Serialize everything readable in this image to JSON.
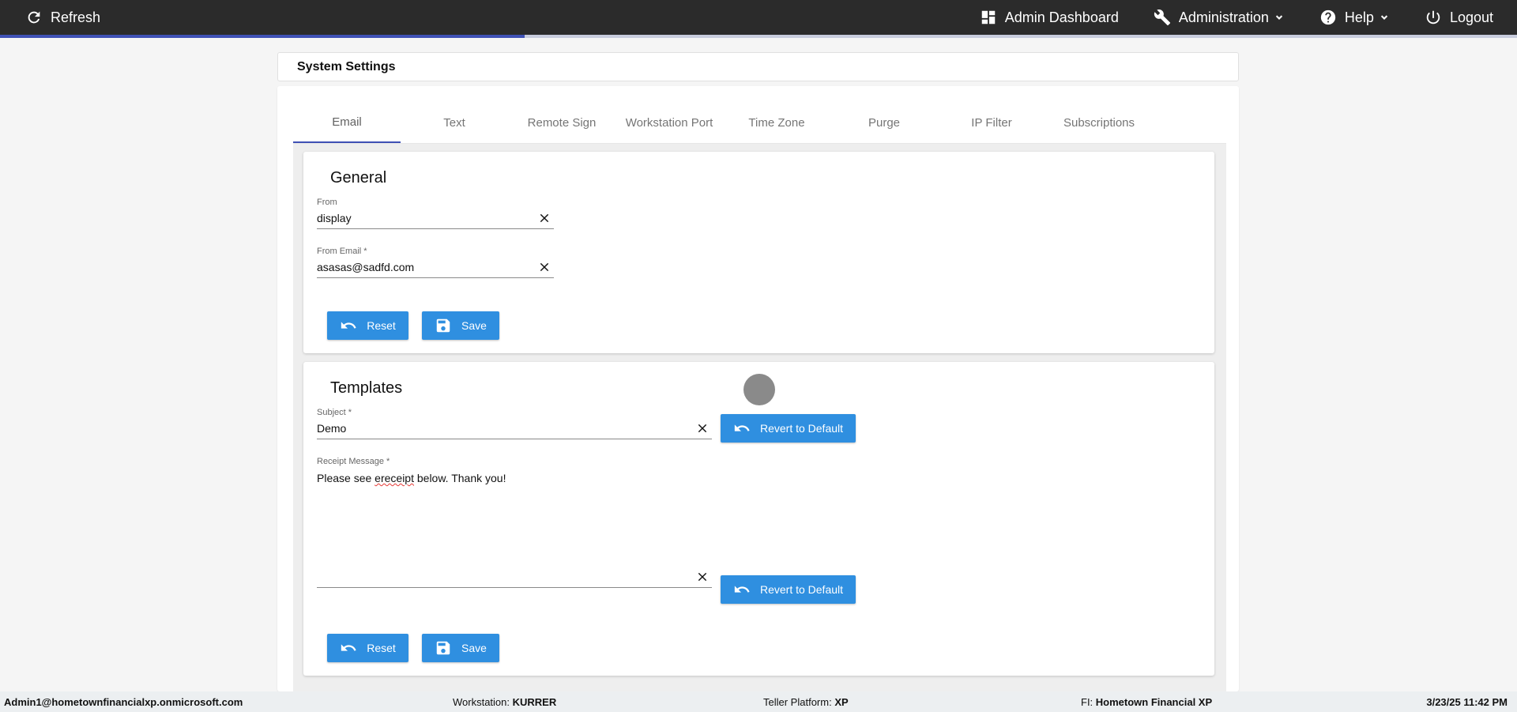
{
  "topbar": {
    "refresh_label": "Refresh",
    "admin_dashboard_label": "Admin Dashboard",
    "administration_label": "Administration",
    "help_label": "Help",
    "logout_label": "Logout",
    "loading_progress_fraction": 0.346
  },
  "page": {
    "title": "System Settings"
  },
  "tabs": [
    {
      "label": "Email",
      "active": true
    },
    {
      "label": "Text"
    },
    {
      "label": "Remote Sign"
    },
    {
      "label": "Workstation Port"
    },
    {
      "label": "Time Zone"
    },
    {
      "label": "Purge"
    },
    {
      "label": "IP Filter"
    },
    {
      "label": "Subscriptions"
    }
  ],
  "general": {
    "heading": "General",
    "from_label": "From",
    "from_value": "display",
    "from_email_label": "From Email *",
    "from_email_value": "asasas@sadfd.com",
    "reset_label": "Reset",
    "save_label": "Save"
  },
  "templates": {
    "heading": "Templates",
    "subject_label": "Subject *",
    "subject_value": "Demo",
    "revert_label": "Revert to Default",
    "receipt_label": "Receipt Message *",
    "receipt_part1": "Please see ",
    "receipt_misspelled": "ereceipt",
    "receipt_part2": " below. Thank you!",
    "second_field_value": "",
    "reset_label": "Reset",
    "save_label": "Save"
  },
  "status": {
    "user": "Admin1@hometownfinancialxp.onmicrosoft.com",
    "workstation_label": "Workstation: ",
    "workstation_value": "KURRER",
    "teller_label": "Teller Platform: ",
    "teller_value": "XP",
    "fi_label": "FI: ",
    "fi_value": "Hometown Financial XP",
    "datetime": "3/23/25 11:42 PM"
  },
  "colors": {
    "topbar_bg": "#2b2b2b",
    "accent": "#3f51b5",
    "button_blue": "#2f8fe0"
  }
}
